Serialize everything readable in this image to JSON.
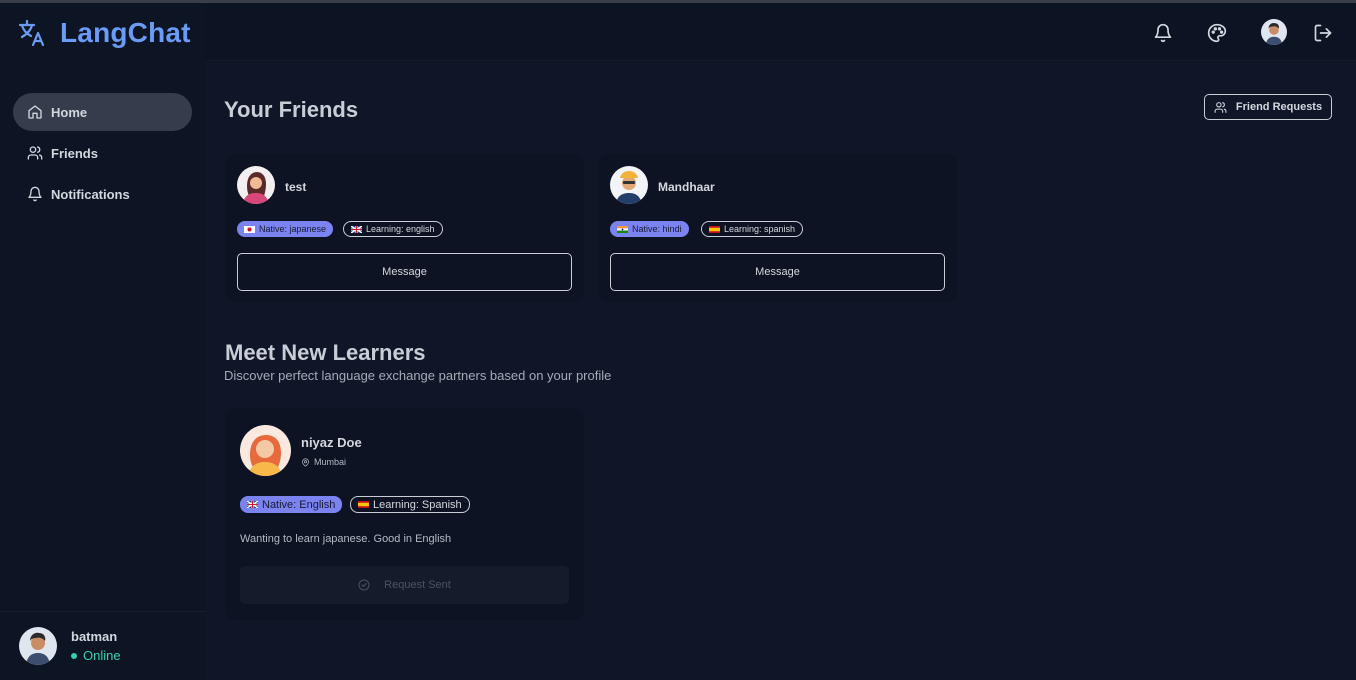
{
  "app": {
    "name": "LangChat"
  },
  "nav": [
    {
      "label": "Home",
      "icon": "home-icon",
      "active": true
    },
    {
      "label": "Friends",
      "icon": "users-icon",
      "active": false
    },
    {
      "label": "Notifications",
      "icon": "bell-icon",
      "active": false
    }
  ],
  "current_user": {
    "name": "batman",
    "status": "Online"
  },
  "friends_section": {
    "title": "Your Friends",
    "requests_label": "Friend Requests",
    "friends": [
      {
        "name": "test",
        "native": "Native: japanese",
        "learning": "Learning: english",
        "button": "Message"
      },
      {
        "name": "Mandhaar",
        "native": "Native: hindi",
        "learning": "Learning: spanish",
        "button": "Message"
      }
    ]
  },
  "learners_section": {
    "title": "Meet New Learners",
    "subtitle": "Discover perfect language exchange partners based on your profile",
    "learners": [
      {
        "name": "niyaz Doe",
        "location": "Mumbai",
        "native": "Native: English",
        "learning": "Learning: Spanish",
        "bio": "Wanting to learn japanese. Good in English",
        "button": "Request Sent"
      }
    ]
  },
  "colors": {
    "accent": "#6b9cf5",
    "native_badge": "#7b83f0",
    "online": "#2ed3a8",
    "background": "#0f1628"
  }
}
